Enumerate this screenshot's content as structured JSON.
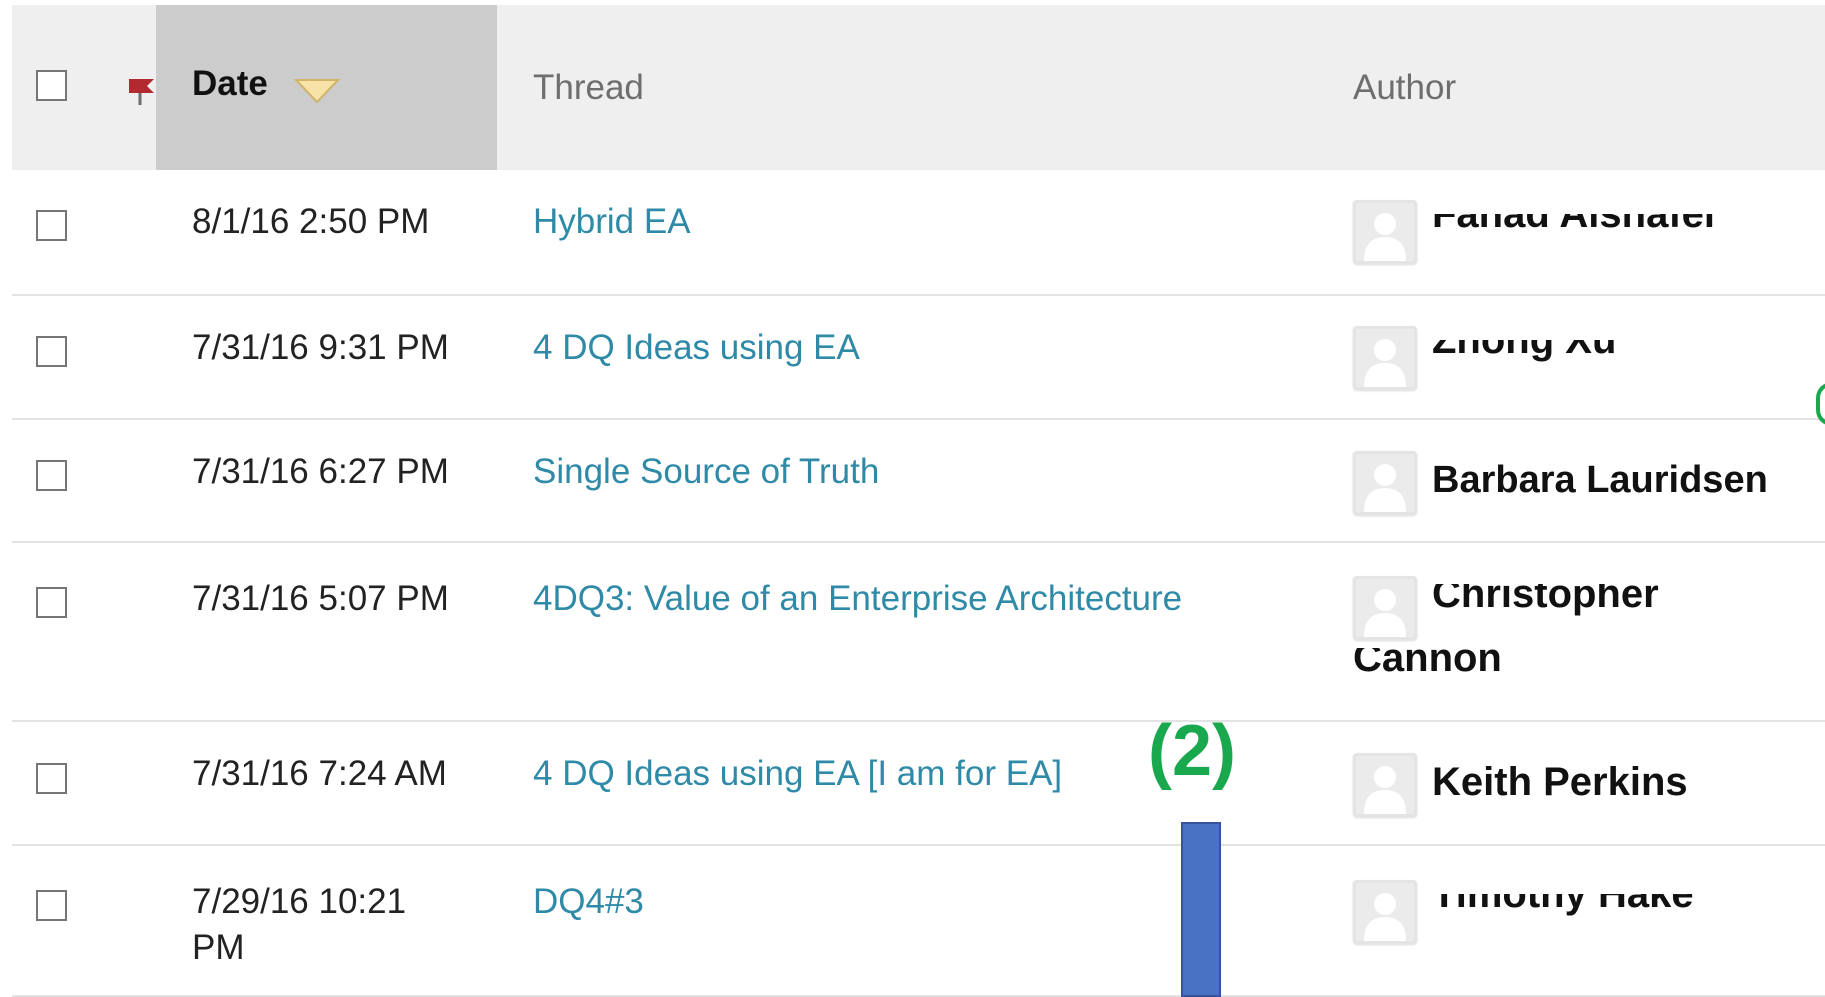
{
  "header": {
    "date_label": "Date",
    "thread_label": "Thread",
    "author_label": "Author"
  },
  "rows": [
    {
      "date": "8/1/16 2:50 PM",
      "thread": "Hybrid EA",
      "author": "Fahad Alshafei"
    },
    {
      "date": "7/31/16 9:31 PM",
      "thread": "4 DQ Ideas using EA",
      "author": "Zhong Xu"
    },
    {
      "date": "7/31/16 6:27 PM",
      "thread": "Single Source of Truth",
      "author": "Barbara Lauridsen"
    },
    {
      "date": "7/31/16 5:07 PM",
      "thread": "4DQ3: Value of an Enterprise Architecture",
      "author": "Christopher",
      "author_line2": "Cannon"
    },
    {
      "date": "7/31/16 7:24 AM",
      "thread": "4 DQ Ideas using EA [I am for EA]",
      "author": "Keith Perkins"
    },
    {
      "date": "7/29/16 10:21",
      "date_line2": "PM",
      "thread": "DQ4#3",
      "author": "Timothy Hake"
    }
  ],
  "annotation": {
    "label": "(2)",
    "color": "#1aa84f",
    "bar_color": "#4a72c4"
  },
  "colors": {
    "link": "#2f8aa8",
    "header_bg": "#efefef",
    "sorted_col_bg": "#cccccc"
  },
  "icons": {
    "flag": "flag-icon",
    "sort": "sort-down-icon",
    "avatar": "default-avatar-icon"
  }
}
